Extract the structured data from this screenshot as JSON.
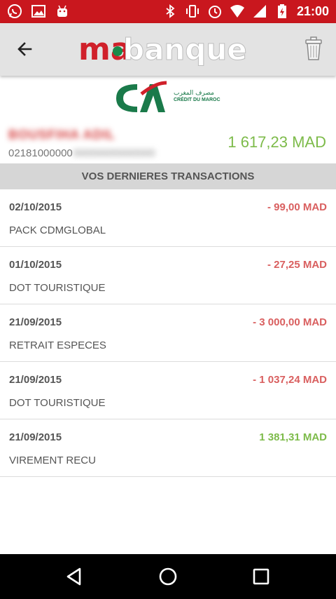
{
  "status_bar": {
    "time": "21:00",
    "left_icons": [
      "whatsapp-icon",
      "gallery-icon",
      "android-icon"
    ],
    "right_icons": [
      "bluetooth-icon",
      "vibrate-icon",
      "alarm-icon",
      "wifi-icon",
      "signal-icon",
      "battery-charging-icon"
    ]
  },
  "app_bar": {
    "logo_prefix": "ma",
    "logo_suffix": "banque",
    "back_icon": "arrow-left-icon",
    "action_icon": "trash-icon"
  },
  "bank": {
    "name": "CRÉDIT DU MAROC",
    "name_ar": "مصرف المغرب",
    "logo_text": "CA"
  },
  "account": {
    "holder_name": "BOUSFIHA ADIL",
    "number_visible": "02181000000",
    "number_hidden": "00000000000000",
    "balance": "1 617,23 MAD"
  },
  "transactions_title": "VOS DERNIERES TRANSACTIONS",
  "transactions": [
    {
      "date": "02/10/2015",
      "amount": "- 99,00 MAD",
      "label": "PACK CDMGLOBAL",
      "type": "debit"
    },
    {
      "date": "01/10/2015",
      "amount": "- 27,25 MAD",
      "label": "DOT TOURISTIQUE",
      "type": "debit"
    },
    {
      "date": "21/09/2015",
      "amount": "- 3 000,00 MAD",
      "label": "RETRAIT ESPECES",
      "type": "debit"
    },
    {
      "date": "21/09/2015",
      "amount": "- 1 037,24 MAD",
      "label": "DOT TOURISTIQUE",
      "type": "debit"
    },
    {
      "date": "21/09/2015",
      "amount": "1 381,31 MAD",
      "label": "VIREMENT RECU",
      "type": "credit"
    }
  ],
  "colors": {
    "status_bar": "#c9171e",
    "brand_red": "#d0202a",
    "brand_green": "#1a8a4a",
    "debit": "#d95f5f",
    "credit": "#7dbb4a"
  },
  "nav_bar": {
    "buttons": [
      "back-triangle-icon",
      "home-circle-icon",
      "recents-square-icon"
    ]
  }
}
